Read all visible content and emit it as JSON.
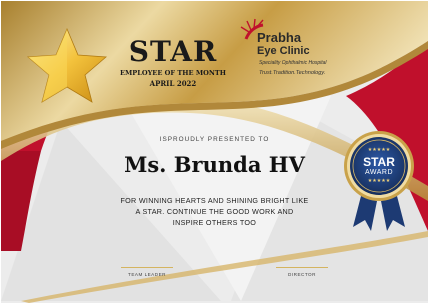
{
  "header": {
    "title": "STAR",
    "subtitle": "EMPLOYEE OF THE MONTH",
    "period": "APRIL 2022"
  },
  "logo": {
    "name_line1": "Prabha",
    "name_line2": "Eye Clinic",
    "tagline1": "Speciality Ophthalmic Hospital",
    "tagline2": "Trust.Tradition.Technology.",
    "icon": "eye-ray-logo-icon"
  },
  "body": {
    "presented": "ISPROUDLY PRESENTED TO",
    "recipient": "Ms. Brunda HV",
    "message_lines": [
      "FOR WINNING HEARTS AND SHINING BRIGHT LIKE",
      "A STAR. CONTINUE THE GOOD WORK AND",
      "INSPIRE OTHERS TOO"
    ]
  },
  "signatures": {
    "left_label": "TEAM LEADER",
    "right_label": "DIRECTOR"
  },
  "badge": {
    "stars_top": "★★★★★",
    "title": "STAR",
    "subtitle": "AWARD",
    "stars_bottom": "★★★★★"
  },
  "colors": {
    "red": "#c0102c",
    "gold": "#c9a24a",
    "navy": "#1d3a73",
    "background": "#e9e9e9"
  }
}
